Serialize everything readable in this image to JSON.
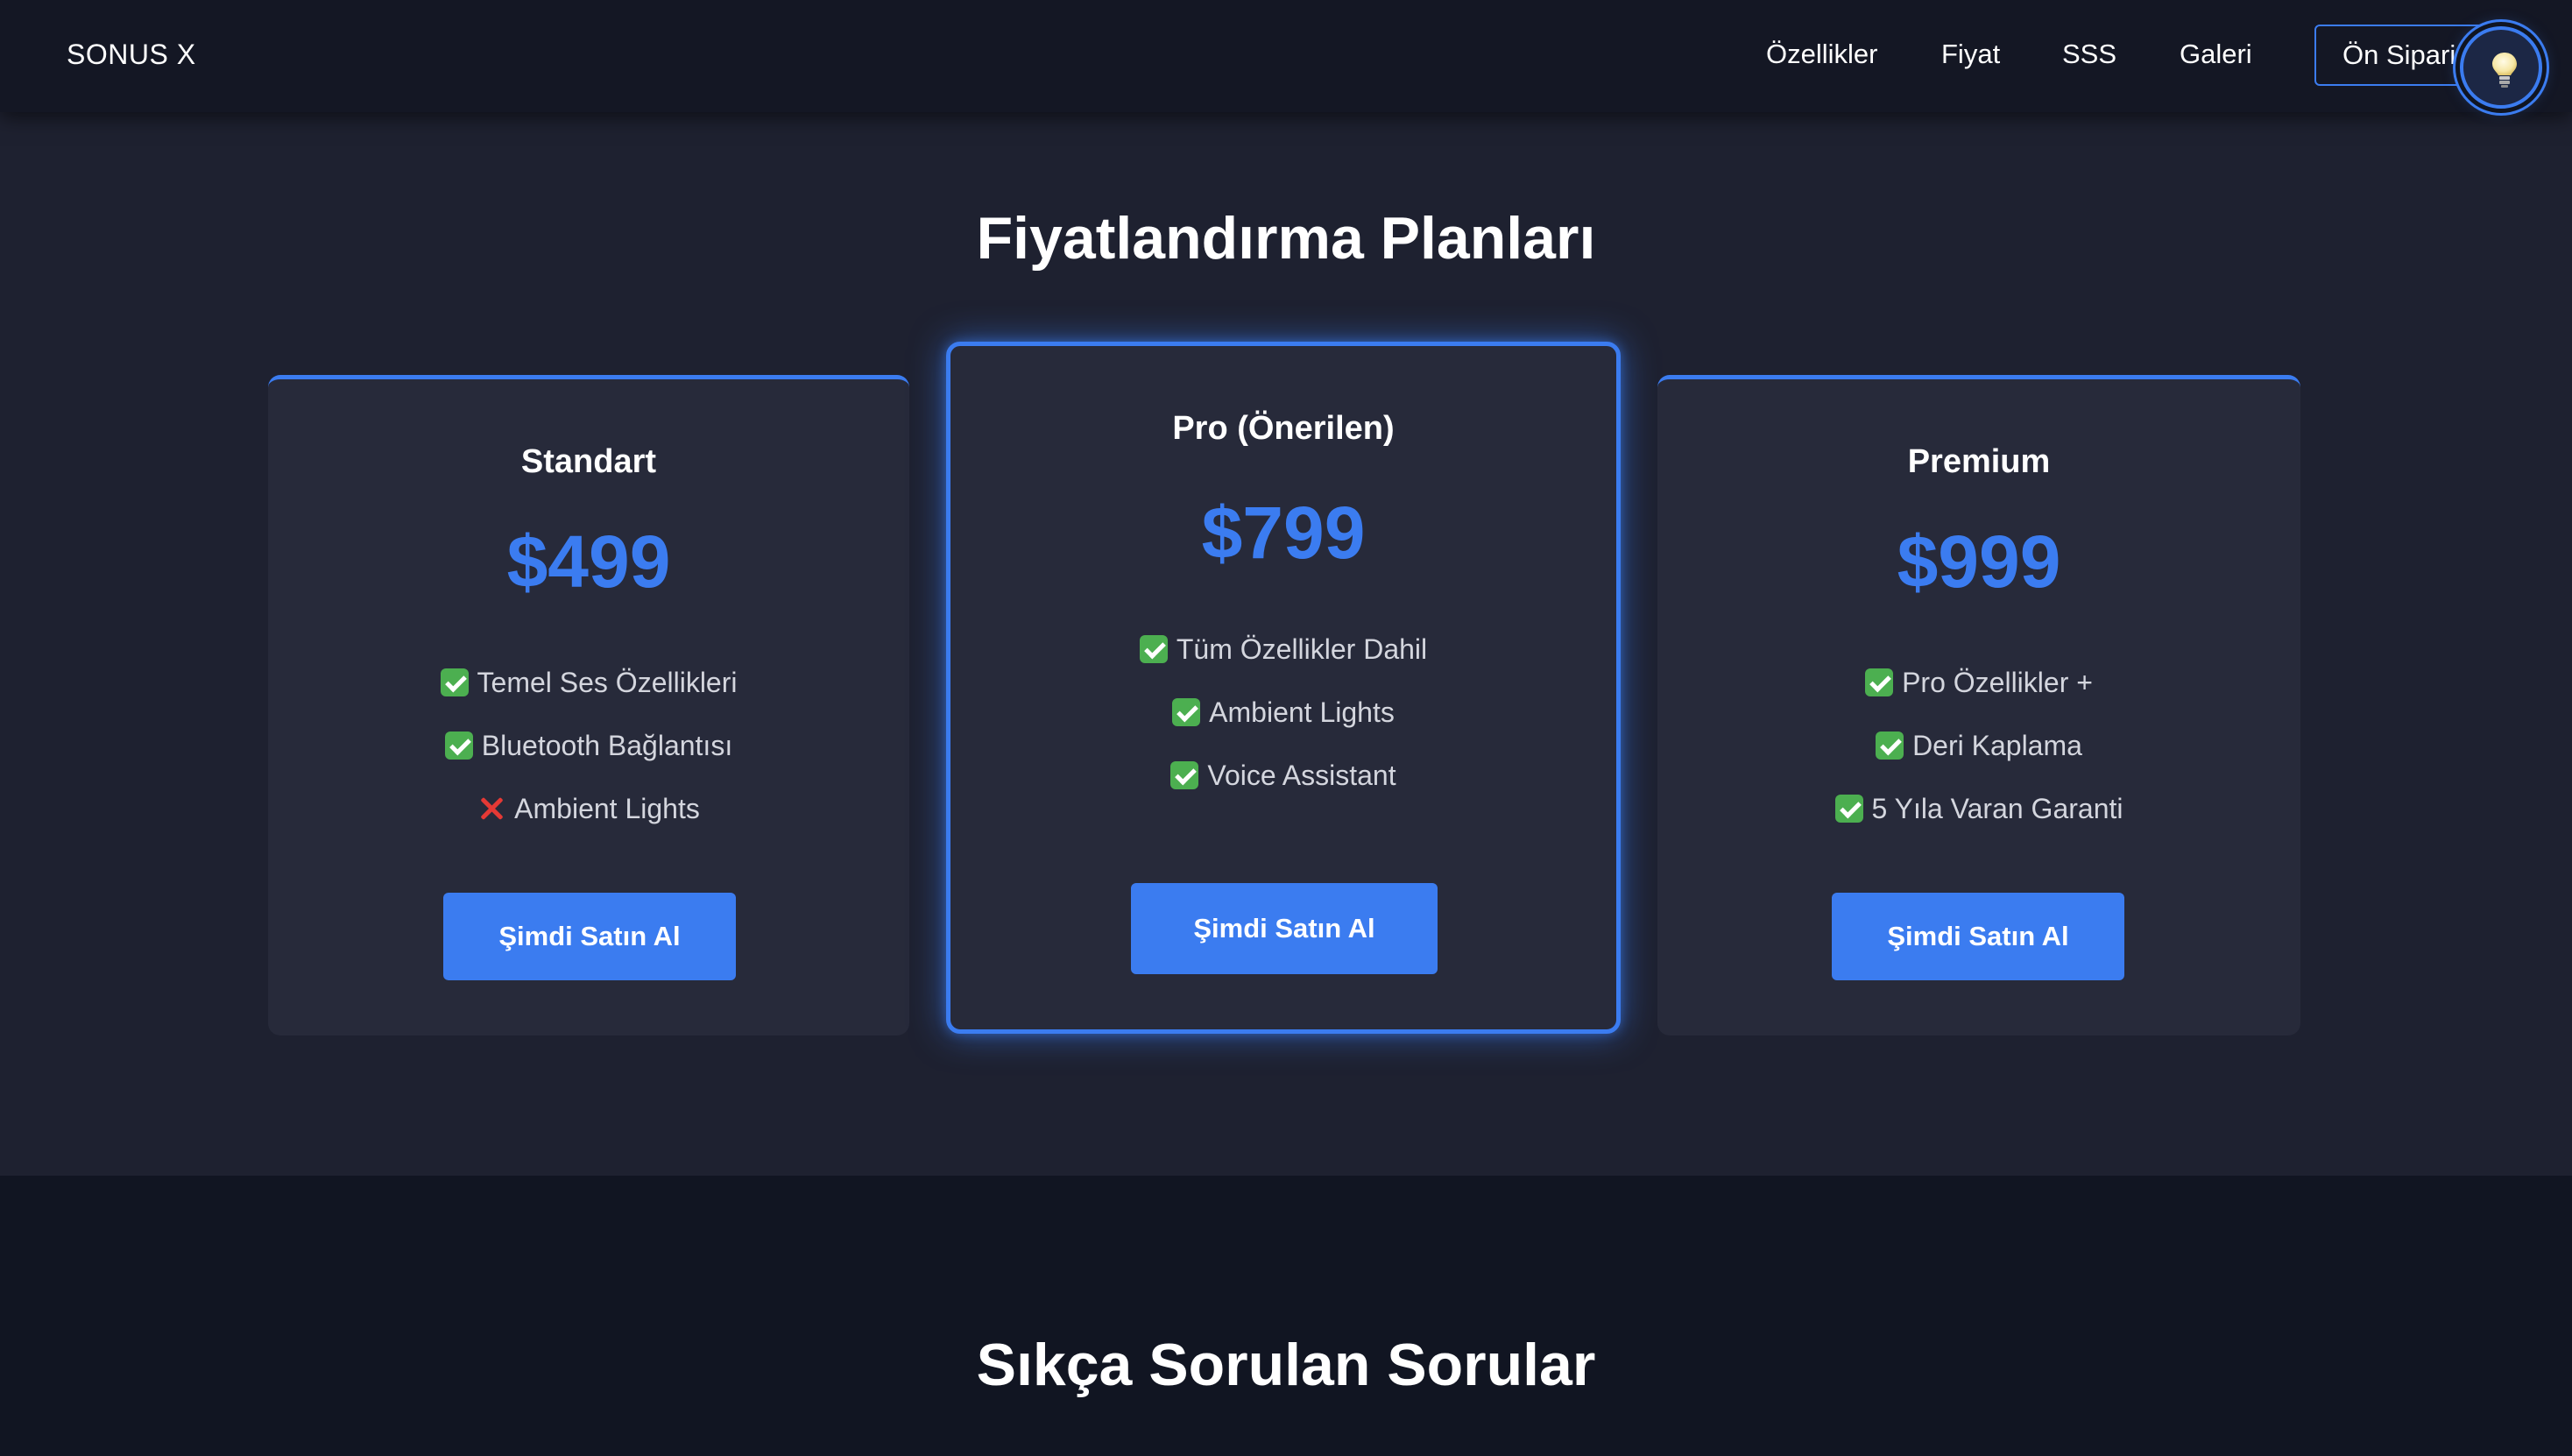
{
  "navbar": {
    "brand": "SONUS X",
    "links": [
      "Özellikler",
      "Fiyat",
      "SSS",
      "Galeri"
    ],
    "preorder_label": "Ön Sipariş",
    "theme_toggle_icon": "lightbulb-icon"
  },
  "pricing": {
    "title": "Fiyatlandırma Planları",
    "plans": [
      {
        "name": "Standart",
        "price": "$499",
        "features": [
          {
            "text": "Temel Ses Özellikleri",
            "included": true
          },
          {
            "text": "Bluetooth Bağlantısı",
            "included": true
          },
          {
            "text": "Ambient Lights",
            "included": false
          }
        ],
        "cta": "Şimdi Satın Al"
      },
      {
        "name": "Pro (Önerilen)",
        "price": "$799",
        "features": [
          {
            "text": "Tüm Özellikler Dahil",
            "included": true
          },
          {
            "text": "Ambient Lights",
            "included": true
          },
          {
            "text": "Voice Assistant",
            "included": true
          }
        ],
        "cta": "Şimdi Satın Al"
      },
      {
        "name": "Premium",
        "price": "$999",
        "features": [
          {
            "text": "Pro Özellikler +",
            "included": true
          },
          {
            "text": "Deri Kaplama",
            "included": true
          },
          {
            "text": "5 Yıla Varan Garanti",
            "included": true
          }
        ],
        "cta": "Şimdi Satın Al"
      }
    ]
  },
  "faq": {
    "title": "Sıkça Sorulan Sorular"
  },
  "colors": {
    "accent": "#3b7cf0",
    "background": "#1e2130",
    "card": "#272a3a",
    "navbar": "#141724",
    "check": "#4caf50",
    "cross": "#e53935"
  }
}
